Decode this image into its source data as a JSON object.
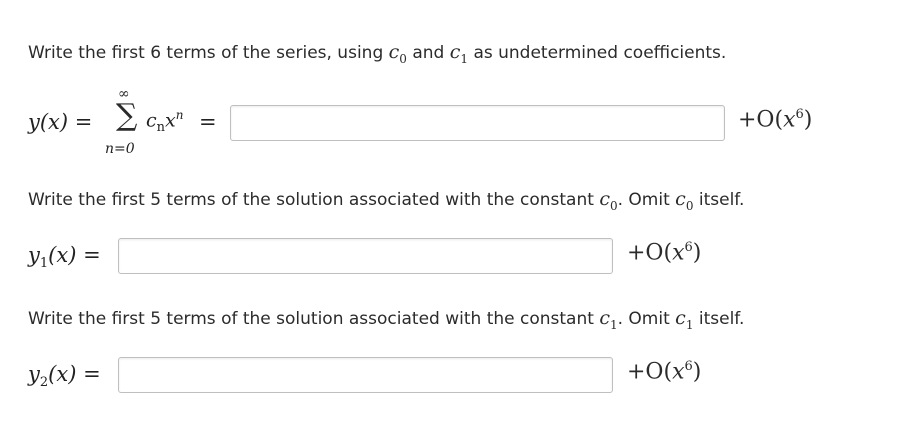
{
  "question1": {
    "prompt_before": "Write the first 6 terms of the series, using",
    "coef_a": "c",
    "coef_a_sub": "0",
    "prompt_mid": "and",
    "coef_b": "c",
    "coef_b_sub": "1",
    "prompt_after": "as undetermined coefficients.",
    "lhs": "y(x)",
    "sum_upper": "∞",
    "sum_symbol": "∑",
    "sum_lower": "n=0",
    "summand_c": "c",
    "summand_sub": "n",
    "summand_x": "x",
    "summand_sup": "n",
    "answer_value": "",
    "order_term_prefix": "+O(",
    "order_term_x": "x",
    "order_term_pow": "6",
    "order_term_suffix": ")"
  },
  "question2": {
    "prompt_before": "Write the first 5 terms of the solution associated with the constant",
    "coef": "c",
    "coef_sub": "0",
    "prompt_after": ". Omit",
    "coef2": "c",
    "coef2_sub": "0",
    "prompt_end": "itself.",
    "lhs_y": "y",
    "lhs_sub": "1",
    "lhs_arg": "(x)",
    "answer_value": "",
    "order_term_prefix": "+O(",
    "order_term_x": "x",
    "order_term_pow": "6",
    "order_term_suffix": ")"
  },
  "question3": {
    "prompt_before": "Write the first 5 terms of the solution associated with the constant",
    "coef": "c",
    "coef_sub": "1",
    "prompt_after": ". Omit",
    "coef2": "c",
    "coef2_sub": "1",
    "prompt_end": "itself.",
    "lhs_y": "y",
    "lhs_sub": "2",
    "lhs_arg": "(x)",
    "answer_value": "",
    "order_term_prefix": "+O(",
    "order_term_x": "x",
    "order_term_pow": "6",
    "order_term_suffix": ")"
  },
  "equals_sign": "="
}
